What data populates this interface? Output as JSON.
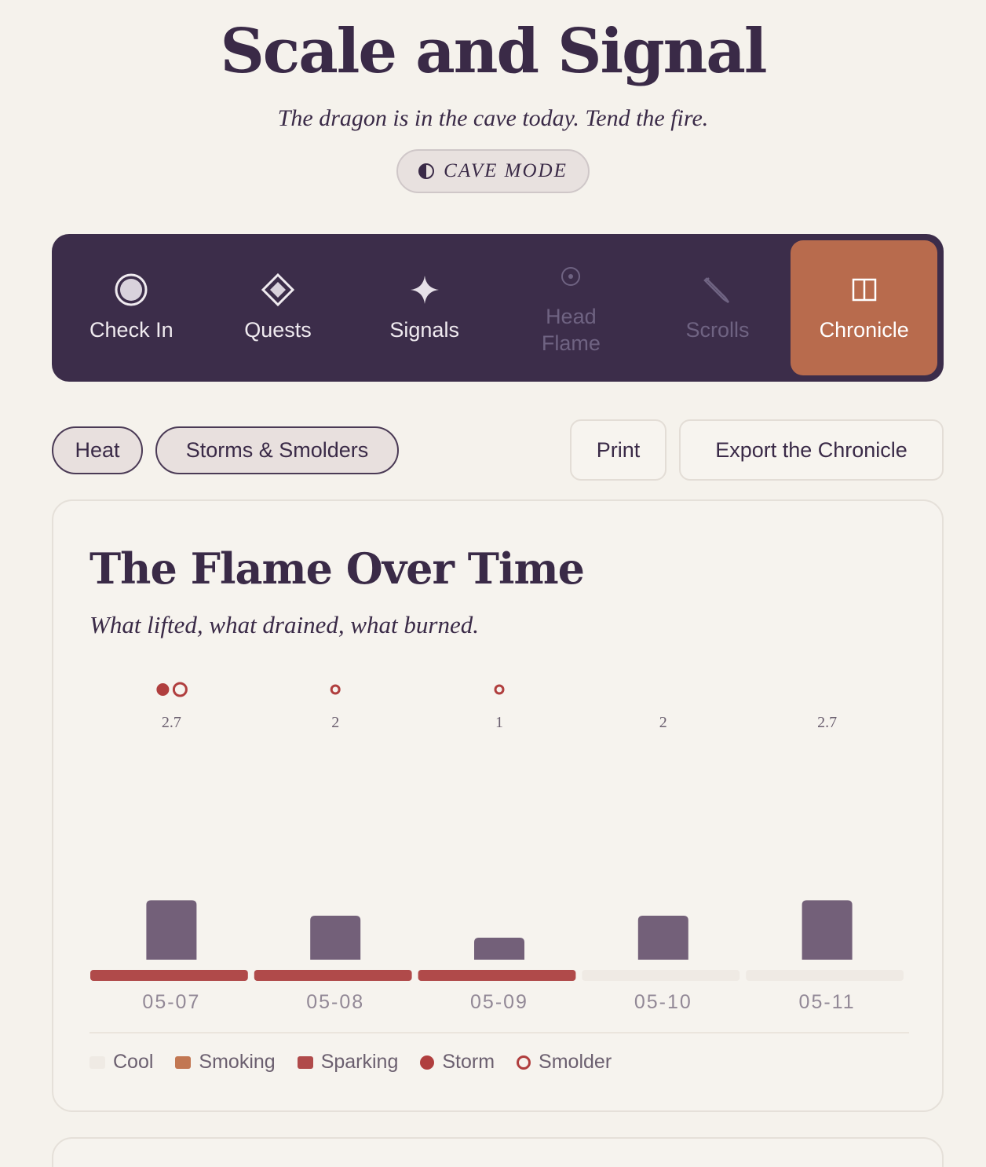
{
  "app": {
    "title": "Scale and Signal",
    "tagline": "The dragon is in the cave today. Tend the fire.",
    "mode_button": "CAVE MODE"
  },
  "nav": {
    "items": [
      {
        "label": "Check In",
        "icon": "circle-target-icon",
        "state": "normal"
      },
      {
        "label": "Quests",
        "icon": "diamond-icon",
        "state": "normal"
      },
      {
        "label": "Signals",
        "icon": "sparkle-icon",
        "state": "normal"
      },
      {
        "label": "Head Flame",
        "icon": "dot-circle-icon",
        "state": "dim"
      },
      {
        "label": "Scrolls",
        "icon": "pencil-icon",
        "state": "dim"
      },
      {
        "label": "Chronicle",
        "icon": "book-icon",
        "state": "active"
      }
    ]
  },
  "filters": {
    "heat": "Heat",
    "storms": "Storms & Smolders"
  },
  "actions": {
    "print": "Print",
    "export": "Export the Chronicle"
  },
  "card": {
    "title": "The Flame Over Time",
    "subtitle": "What lifted, what drained, what burned."
  },
  "colors": {
    "bar": "#736079",
    "cool": "#efeae4",
    "smoking": "#c27752",
    "sparking": "#b04a4a",
    "storm": "#b03e3e",
    "accent_active": "#b86b4d",
    "nav_bg": "#3c2d4a"
  },
  "chart_data": {
    "type": "bar",
    "categories": [
      "05-07",
      "05-08",
      "05-09",
      "05-10",
      "05-11"
    ],
    "values": [
      2.7,
      2,
      1,
      2,
      2.7
    ],
    "value_labels": [
      "2.7",
      "2",
      "1",
      "2",
      "2.7"
    ],
    "heat": [
      "Sparking",
      "Sparking",
      "Sparking",
      "Cool",
      "Cool"
    ],
    "events": [
      [
        "Storm",
        "Smolder"
      ],
      [
        "Smolder"
      ],
      [
        "Smolder"
      ],
      [],
      []
    ],
    "legend": [
      "Cool",
      "Smoking",
      "Sparking",
      "Storm",
      "Smolder"
    ],
    "ylim": [
      0,
      10
    ]
  }
}
